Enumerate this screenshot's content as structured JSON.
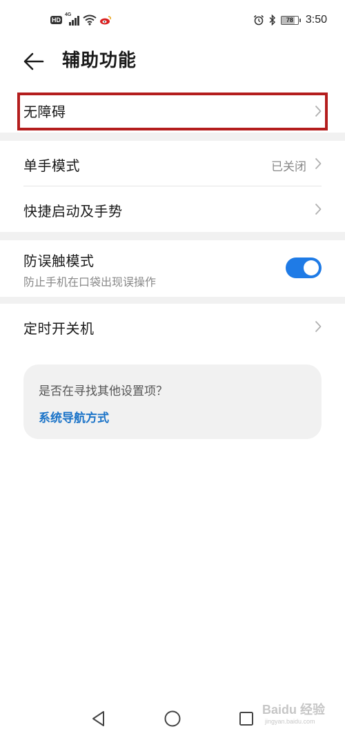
{
  "status_bar": {
    "hd_label": "HD",
    "network_label": "4G",
    "battery_level": "78",
    "time": "3:50",
    "icons": [
      "hd-icon",
      "signal-icon",
      "wifi-icon",
      "weibo-icon",
      "alarm-icon",
      "bluetooth-icon",
      "battery-icon"
    ]
  },
  "header": {
    "title": "辅助功能",
    "back_icon": "arrow-left-icon"
  },
  "settings": {
    "accessibility": {
      "label": "无障碍"
    },
    "one_hand": {
      "label": "单手模式",
      "value": "已关闭"
    },
    "shortcuts": {
      "label": "快捷启动及手势"
    },
    "pocket_mode": {
      "label": "防误触模式",
      "description": "防止手机在口袋出现误操作",
      "enabled": true
    },
    "scheduled_power": {
      "label": "定时开关机"
    }
  },
  "suggestion": {
    "question": "是否在寻找其他设置项？",
    "link": "系统导航方式"
  },
  "nav_bar": {
    "buttons": [
      "back-triangle-icon",
      "home-circle-icon",
      "recents-square-icon"
    ]
  },
  "watermark": {
    "brand": "Baidu 经验",
    "url": "jingyan.baidu.com"
  },
  "colors": {
    "accent": "#1f7be6",
    "link": "#1a73c8",
    "highlight_frame": "#b41d1d",
    "band": "#f1f1f1"
  }
}
